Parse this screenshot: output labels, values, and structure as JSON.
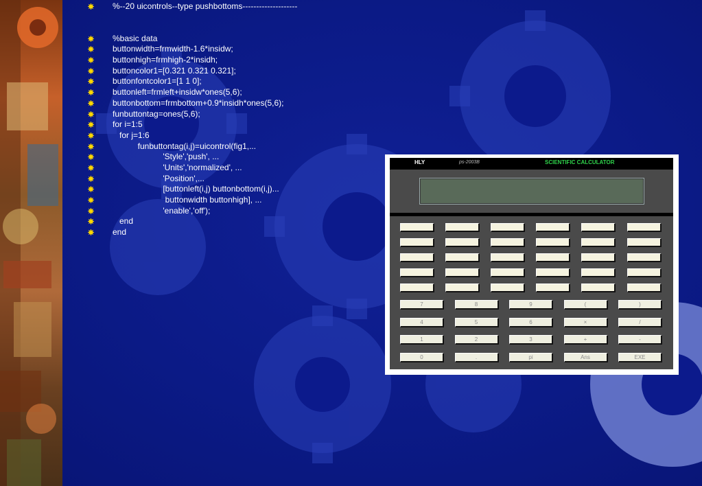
{
  "code_lines": [
    "%--20 uicontrols--type pushbottoms--------------------",
    "",
    "%basic data",
    "buttonwidth=frmwidth-1.6*insidw;",
    "buttonhigh=frmhigh-2*insidh;",
    "buttoncolor1=[0.321 0.321 0.321];",
    "buttonfontcolor1=[1 1 0];",
    "buttonleft=frmleft+insidw*ones(5,6);",
    "buttonbottom=frmbottom+0.9*insidh*ones(5,6);",
    "funbuttontag=ones(5,6);",
    "for i=1:5",
    "   for j=1:6",
    "           funbuttontag(i,j)=uicontrol(fig1,...",
    "                      'Style','push', ...",
    "                      'Units','normalized', ...",
    "                      'Position',...",
    "                      [buttonleft(i,j) buttonbottom(i,j)...",
    "                       buttonwidth buttonhigh], ...",
    "                      'enable','off');",
    "   end",
    "end"
  ],
  "calculator": {
    "brand": "HLY",
    "model": "ps-2003B",
    "title": "SCIENTIFIC CALCULATOR",
    "function_rows": 5,
    "function_cols": 6,
    "number_keys": [
      [
        "7",
        "8",
        "9",
        "(",
        ")"
      ],
      [
        "4",
        "5",
        "6",
        "×",
        "/"
      ],
      [
        "1",
        "2",
        "3",
        "+",
        "-"
      ],
      [
        "0",
        ".",
        "pi",
        "Ans",
        "EXE"
      ]
    ]
  },
  "colors": {
    "background": "#0c1a8c",
    "bullet": "#ffd700",
    "text": "#ffffff",
    "calc_title": "#2fd24a",
    "calc_body": "#4a4a4a",
    "display": "#596a59"
  }
}
